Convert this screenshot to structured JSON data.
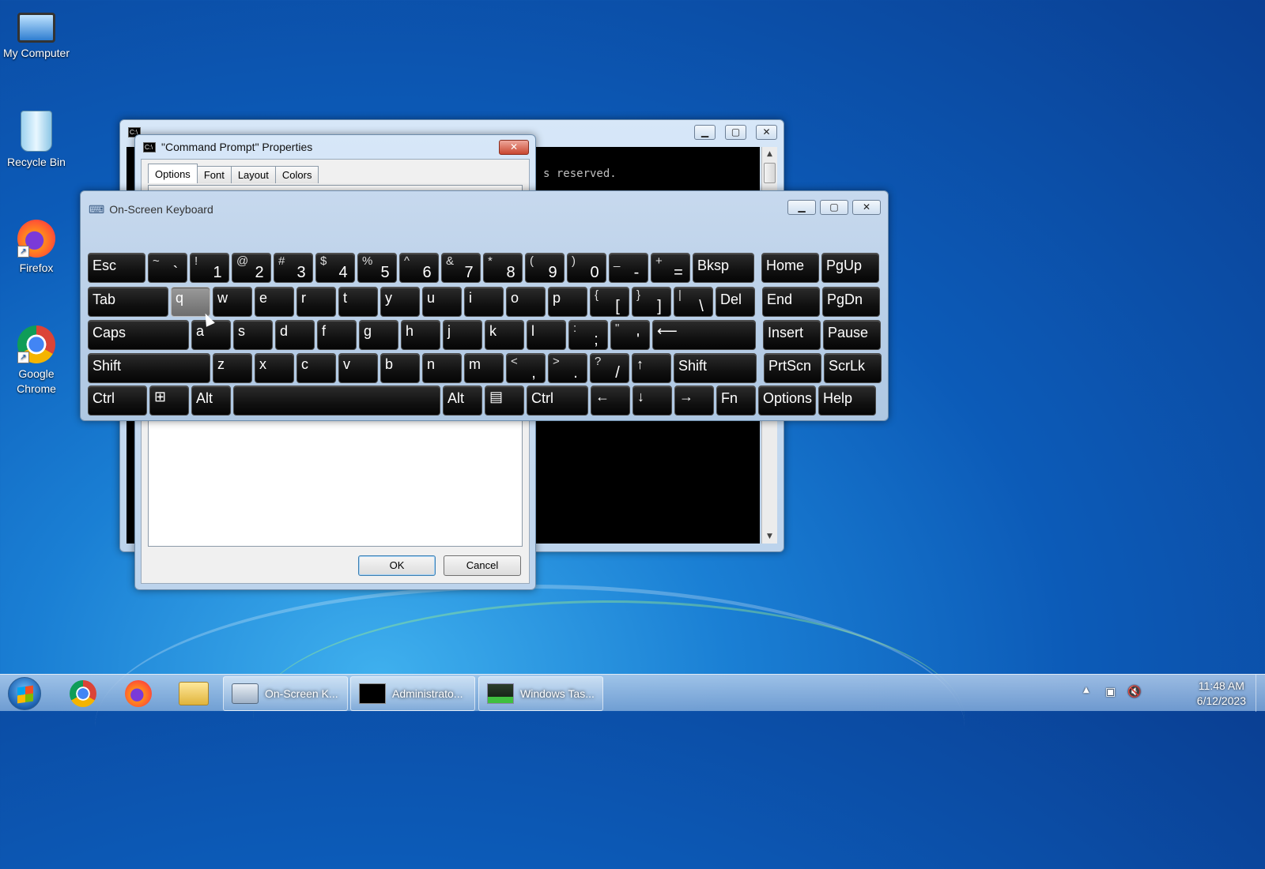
{
  "desktop": {
    "icons": [
      {
        "label": "My Computer"
      },
      {
        "label": "Recycle Bin"
      },
      {
        "label": "Firefox"
      },
      {
        "label": "Google Chrome"
      }
    ]
  },
  "cmd_window": {
    "console_line": "s reserved."
  },
  "properties_dialog": {
    "title": "\"Command Prompt\" Properties",
    "tabs": [
      "Options",
      "Font",
      "Layout",
      "Colors"
    ],
    "ok_label": "OK",
    "cancel_label": "Cancel"
  },
  "osk": {
    "title": "On-Screen Keyboard",
    "rows": [
      [
        {
          "label": "Esc"
        },
        {
          "top": "~",
          "bot": "`"
        },
        {
          "top": "!",
          "bot": "1"
        },
        {
          "top": "@",
          "bot": "2"
        },
        {
          "top": "#",
          "bot": "3"
        },
        {
          "top": "$",
          "bot": "4"
        },
        {
          "top": "%",
          "bot": "5"
        },
        {
          "top": "^",
          "bot": "6"
        },
        {
          "top": "&",
          "bot": "7"
        },
        {
          "top": "*",
          "bot": "8"
        },
        {
          "top": "(",
          "bot": "9"
        },
        {
          "top": ")",
          "bot": "0"
        },
        {
          "top": "_",
          "bot": "-"
        },
        {
          "top": "+",
          "bot": "="
        },
        {
          "label": "Bksp"
        },
        {
          "label": "Home"
        },
        {
          "label": "PgUp"
        }
      ],
      [
        {
          "label": "Tab"
        },
        {
          "label": "q"
        },
        {
          "label": "w"
        },
        {
          "label": "e"
        },
        {
          "label": "r"
        },
        {
          "label": "t"
        },
        {
          "label": "y"
        },
        {
          "label": "u"
        },
        {
          "label": "i"
        },
        {
          "label": "o"
        },
        {
          "label": "p"
        },
        {
          "top": "{",
          "bot": "["
        },
        {
          "top": "}",
          "bot": "]"
        },
        {
          "top": "|",
          "bot": "\\"
        },
        {
          "label": "Del"
        },
        {
          "label": "End"
        },
        {
          "label": "PgDn"
        }
      ],
      [
        {
          "label": "Caps"
        },
        {
          "label": "a"
        },
        {
          "label": "s"
        },
        {
          "label": "d"
        },
        {
          "label": "f"
        },
        {
          "label": "g"
        },
        {
          "label": "h"
        },
        {
          "label": "j"
        },
        {
          "label": "k"
        },
        {
          "label": "l"
        },
        {
          "top": ":",
          "bot": ";"
        },
        {
          "top": "\"",
          "bot": "'"
        },
        {
          "label": "⟵"
        },
        {
          "label": "Insert"
        },
        {
          "label": "Pause"
        }
      ],
      [
        {
          "label": "Shift"
        },
        {
          "label": "z"
        },
        {
          "label": "x"
        },
        {
          "label": "c"
        },
        {
          "label": "v"
        },
        {
          "label": "b"
        },
        {
          "label": "n"
        },
        {
          "label": "m"
        },
        {
          "top": "<",
          "bot": ","
        },
        {
          "top": ">",
          "bot": "."
        },
        {
          "top": "?",
          "bot": "/"
        },
        {
          "label": "↑"
        },
        {
          "label": "Shift"
        },
        {
          "label": "PrtScn"
        },
        {
          "label": "ScrLk"
        }
      ],
      [
        {
          "label": "Ctrl"
        },
        {
          "label": "⊞"
        },
        {
          "label": "Alt"
        },
        {
          "label": ""
        },
        {
          "label": "Alt"
        },
        {
          "label": "▤"
        },
        {
          "label": "Ctrl"
        },
        {
          "label": "←"
        },
        {
          "label": "↓"
        },
        {
          "label": "→"
        },
        {
          "label": "Fn"
        },
        {
          "label": "Options"
        },
        {
          "label": "Help"
        }
      ]
    ]
  },
  "taskbar": {
    "tasks": [
      {
        "label": "On-Screen K..."
      },
      {
        "label": "Administrato..."
      },
      {
        "label": "Windows Tas..."
      }
    ],
    "time": "11:48 AM",
    "date": "6/12/2023"
  },
  "colors": {
    "desktop": "#0c5bb8",
    "key": "#111111",
    "key_hover": "#8a8a8a"
  }
}
